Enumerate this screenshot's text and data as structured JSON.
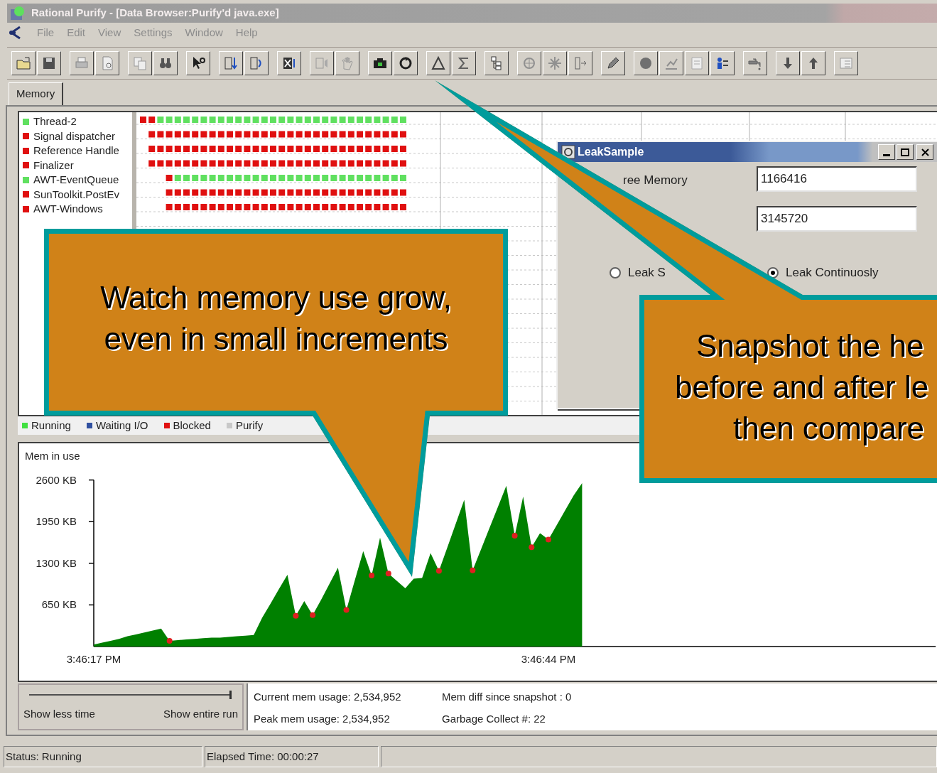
{
  "window": {
    "title": "Rational Purify - [Data Browser:Purify'd java.exe]"
  },
  "menu": [
    {
      "label": "File",
      "disabled": true
    },
    {
      "label": "Edit",
      "disabled": true
    },
    {
      "label": "View",
      "disabled": true
    },
    {
      "label": "Settings",
      "disabled": true
    },
    {
      "label": "Window",
      "disabled": true
    },
    {
      "label": "Help",
      "disabled": true
    }
  ],
  "tabs": [
    {
      "label": "Memory",
      "selected": true
    }
  ],
  "threads": [
    {
      "name": "Thread-2",
      "color": "#60e060"
    },
    {
      "name": "Signal dispatcher",
      "color": "#e01010"
    },
    {
      "name": "Reference Handle",
      "color": "#e01010"
    },
    {
      "name": "Finalizer",
      "color": "#e01010"
    },
    {
      "name": "AWT-EventQueue",
      "color": "#60e060"
    },
    {
      "name": "SunToolkit.PostEv",
      "color": "#e01010"
    },
    {
      "name": "AWT-Windows",
      "color": "#e01010"
    }
  ],
  "legend": [
    {
      "label": "Running",
      "color": "#40e040"
    },
    {
      "label": "Waiting I/O",
      "color": "#3050a0"
    },
    {
      "label": "Blocked",
      "color": "#e01010"
    },
    {
      "label": "Purify",
      "color": "#c8c8c8"
    }
  ],
  "memory_chart": {
    "chart_data": {
      "type": "area",
      "title": "Mem in use",
      "categories": [
        "3:46:17 PM",
        null,
        null,
        null,
        null,
        null,
        null,
        null,
        null,
        null,
        null,
        null,
        null,
        null,
        null,
        null,
        null,
        null,
        null,
        null,
        null,
        null,
        null,
        null,
        null,
        null,
        null,
        null,
        null,
        null,
        null,
        null,
        null,
        null,
        null,
        null,
        null,
        null,
        null,
        null,
        null,
        null,
        null,
        null,
        null,
        null,
        null,
        null,
        null,
        null,
        null,
        null,
        null,
        null,
        "3:46:44 PM",
        null,
        null,
        null,
        null,
        null,
        null,
        null,
        null,
        null,
        null,
        null,
        null,
        null,
        null,
        null,
        null,
        null,
        null,
        null,
        null,
        null,
        null,
        null,
        null,
        null,
        null,
        null,
        null,
        null,
        null,
        null,
        null,
        null,
        null,
        null,
        null,
        null,
        null,
        null,
        null,
        null,
        null,
        null,
        null,
        null,
        null
      ],
      "series": [
        {
          "color": "#008000",
          "values": [
            30,
            60,
            90,
            120,
            160,
            190,
            220,
            250,
            280,
            90,
            100,
            110,
            120,
            130,
            140,
            140,
            150,
            160,
            170,
            180,
            450,
            670,
            900,
            1120,
            480,
            710,
            490,
            730,
            980,
            1230,
            570,
            1030,
            1490,
            1110,
            1700,
            1140,
            null,
            910,
            1060,
            1070,
            1460,
            1180,
            1550,
            1920,
            2290,
            1190,
            1520,
            1850,
            2180,
            2510,
            1730,
            2340,
            1550,
            1770,
            1670,
            1900,
            2130,
            2360,
            2550,
            null,
            null,
            null,
            null,
            null,
            null,
            null,
            null,
            null,
            null,
            null,
            null,
            null,
            null,
            null,
            null,
            null,
            null,
            null,
            null,
            null,
            null,
            null,
            null,
            null,
            null,
            null,
            null,
            null,
            null,
            null,
            null,
            null,
            null,
            null,
            null,
            null,
            null,
            null,
            null,
            null,
            null
          ]
        }
      ],
      "ylim": [
        0,
        2600
      ],
      "yticks": [
        {
          "value": 650,
          "label": "650 KB"
        },
        {
          "value": 1300,
          "label": "1300 KB"
        },
        {
          "value": 1950,
          "label": "1950 KB"
        },
        {
          "value": 2600,
          "label": "2600 KB"
        }
      ]
    }
  },
  "time_slider": {
    "level": 1,
    "left_label": "Show less time",
    "right_label": "Show entire run"
  },
  "stats": [
    "Current mem usage: 2,534,952",
    "Mem diff since snapshot : 0",
    "Peak mem usage: 2,534,952",
    "Garbage Collect #: 22"
  ],
  "status_bar": [
    "Status: Running",
    "Elapsed Time: 00:00:27"
  ],
  "dialog": {
    "title": "LeakSample",
    "fields": [
      {
        "label": "ree Memory",
        "value": "1166416"
      },
      {
        "value": "3145720"
      }
    ],
    "radios": [
      {
        "label": "Leak S",
        "selected": false
      },
      {
        "label": "Leak Continuosly",
        "selected": true
      }
    ]
  },
  "callouts": [
    {
      "lines": [
        "Watch memory use grow,",
        "even in small increments"
      ]
    },
    {
      "lines": [
        "Snapshot the he",
        "before and after le",
        "then compare"
      ]
    }
  ]
}
